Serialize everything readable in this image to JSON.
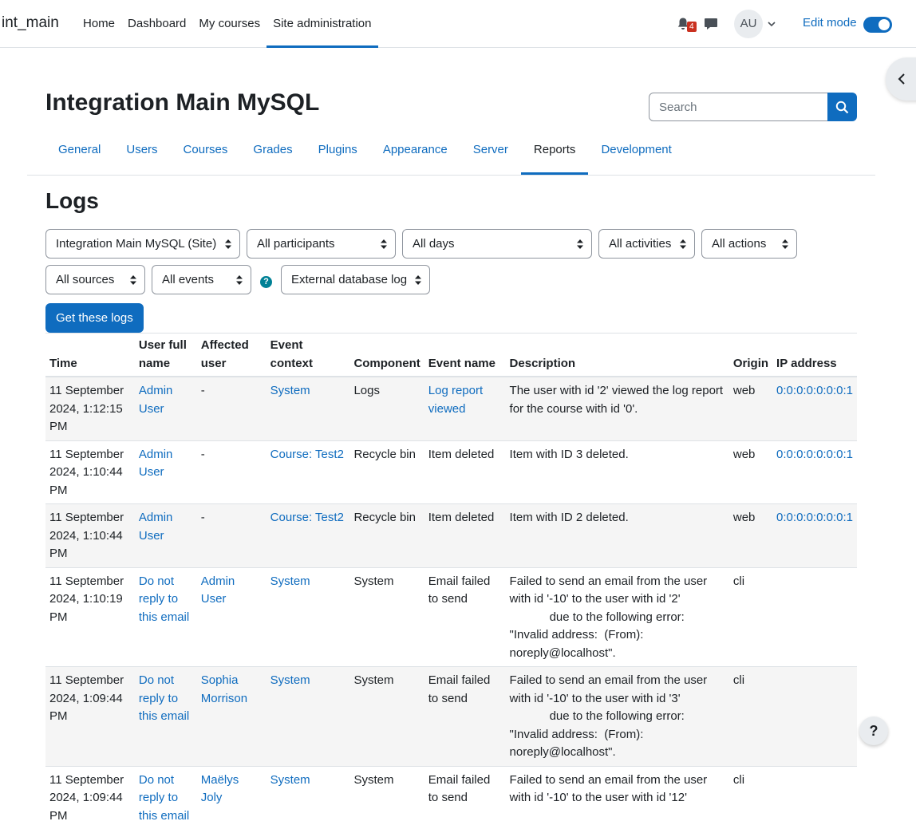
{
  "navbar": {
    "brand": "int_main",
    "items": [
      {
        "label": "Home"
      },
      {
        "label": "Dashboard"
      },
      {
        "label": "My courses"
      },
      {
        "label": "Site administration"
      }
    ],
    "notification_count": "4",
    "avatar_initials": "AU",
    "edit_mode_label": "Edit mode",
    "edit_mode_on": true
  },
  "header": {
    "title": "Integration Main MySQL",
    "search_placeholder": "Search"
  },
  "secondary_nav": {
    "tabs": [
      {
        "label": "General"
      },
      {
        "label": "Users"
      },
      {
        "label": "Courses"
      },
      {
        "label": "Grades"
      },
      {
        "label": "Plugins"
      },
      {
        "label": "Appearance"
      },
      {
        "label": "Server"
      },
      {
        "label": "Reports"
      },
      {
        "label": "Development"
      }
    ]
  },
  "logs": {
    "heading": "Logs",
    "filters": {
      "course": "Integration Main MySQL (Site)",
      "participants": "All participants",
      "days": "All days",
      "activities": "All activities",
      "actions": "All actions",
      "sources": "All sources",
      "events": "All events",
      "log_reader": "External database log"
    },
    "help_glyph": "?",
    "get_button": "Get these logs"
  },
  "table": {
    "headers": {
      "time": "Time",
      "user": "User full name",
      "affected": "Affected user",
      "context": "Event context",
      "component": "Component",
      "event": "Event name",
      "description": "Description",
      "origin": "Origin",
      "ip": "IP address"
    },
    "rows": [
      {
        "time": "11 September 2024, 1:12:15 PM",
        "user": "Admin User",
        "affected": "-",
        "context": "System",
        "component": "Logs",
        "event": "Log report viewed",
        "description": "The user with id '2' viewed the log report for the course with id '0'.",
        "origin": "web",
        "ip": "0:0:0:0:0:0:0:1"
      },
      {
        "time": "11 September 2024, 1:10:44 PM",
        "user": "Admin User",
        "affected": "-",
        "context": "Course: Test2",
        "component": "Recycle bin",
        "event": "Item deleted",
        "description": "Item with ID 3 deleted.",
        "origin": "web",
        "ip": "0:0:0:0:0:0:0:1"
      },
      {
        "time": "11 September 2024, 1:10:44 PM",
        "user": "Admin User",
        "affected": "-",
        "context": "Course: Test2",
        "component": "Recycle bin",
        "event": "Item deleted",
        "description": "Item with ID 2 deleted.",
        "origin": "web",
        "ip": "0:0:0:0:0:0:0:1"
      },
      {
        "time": "11 September 2024, 1:10:19 PM",
        "user": "Do not reply to this email",
        "affected": "Admin User",
        "context": "System",
        "component": "System",
        "event": "Email failed to send",
        "description": "Failed to send an email from the user with id '-10' to the user with id '2'\n            due to the following error: \"Invalid address:  (From): noreply@localhost\".",
        "origin": "cli",
        "ip": ""
      },
      {
        "time": "11 September 2024, 1:09:44 PM",
        "user": "Do not reply to this email",
        "affected": "Sophia Morrison",
        "context": "System",
        "component": "System",
        "event": "Email failed to send",
        "description": "Failed to send an email from the user with id '-10' to the user with id '3'\n            due to the following error: \"Invalid address:  (From): noreply@localhost\".",
        "origin": "cli",
        "ip": ""
      },
      {
        "time": "11 September 2024, 1:09:44 PM",
        "user": "Do not reply to this email",
        "affected": "Maëlys Joly",
        "context": "System",
        "component": "System",
        "event": "Email failed to send",
        "description": "Failed to send an email from the user with id '-10' to the user with id '12'",
        "origin": "cli",
        "ip": ""
      }
    ]
  },
  "help_fab": "?",
  "colors": {
    "primary": "#0f6cbf",
    "badge": "#ca3120",
    "help_icon": "#008196"
  }
}
